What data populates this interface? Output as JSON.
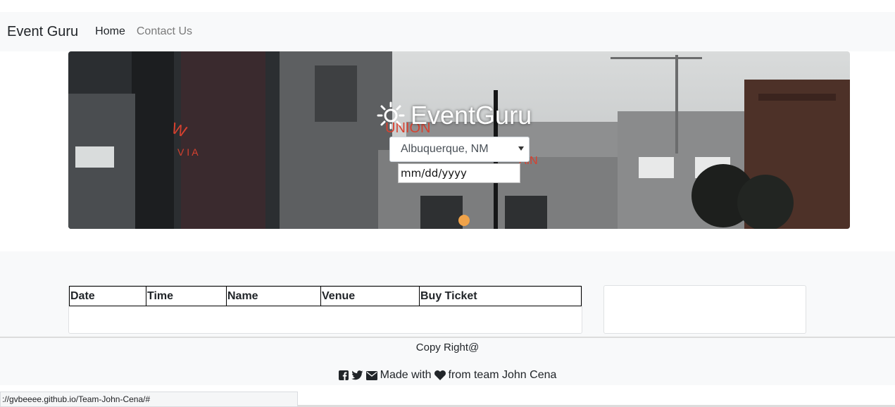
{
  "navbar": {
    "brand": "Event Guru",
    "links": [
      {
        "label": "Home"
      },
      {
        "label": "Contact Us"
      }
    ]
  },
  "hero": {
    "title": "EventGuru",
    "city_select": {
      "value": "Albuquerque, NM"
    },
    "date_input": {
      "placeholder": "mm/dd/yyyy"
    }
  },
  "events_table": {
    "headers": [
      "Date",
      "Time",
      "Name",
      "Venue",
      "Buy Ticket"
    ],
    "rows": []
  },
  "footer": {
    "copyright": "Copy Right@",
    "made_with_prefix": "Made with",
    "made_with_suffix": "from team John Cena"
  },
  "status_bar": {
    "url": "://gvbeeee.github.io/Team-John-Cena/#"
  },
  "colors": {
    "navbar_bg": "#f8f9fa",
    "link_muted": "#7a7a7a",
    "text": "#212529"
  }
}
